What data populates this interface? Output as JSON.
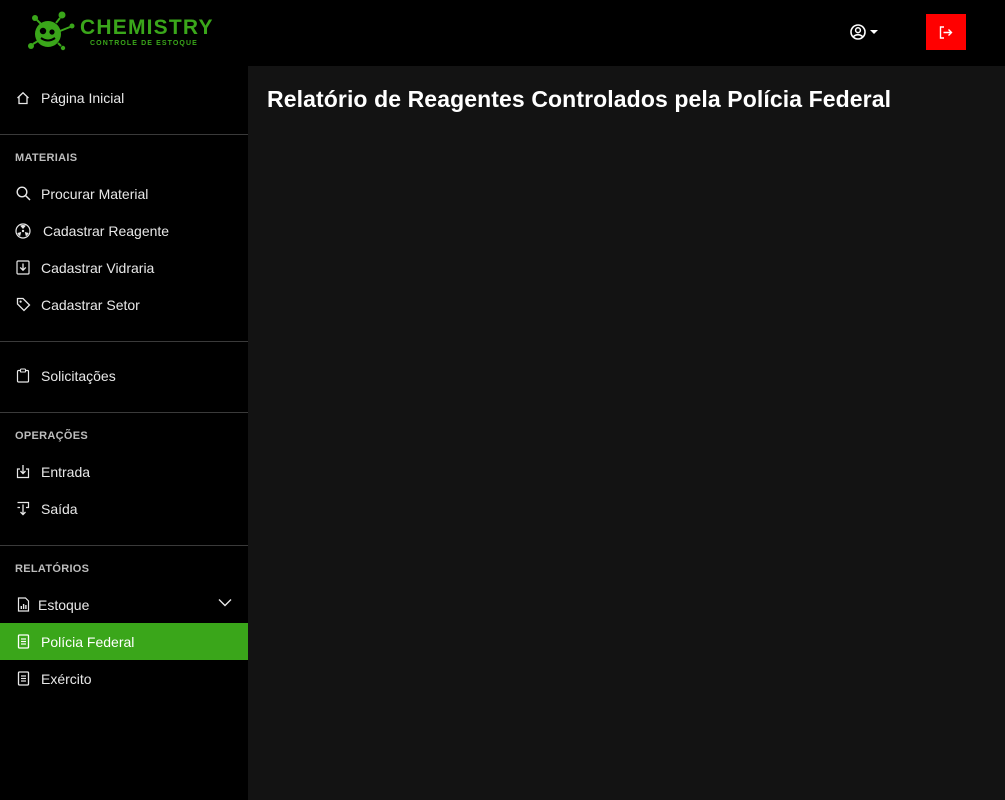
{
  "brand": {
    "title": "CHEMISTRY",
    "subtitle": "CONTROLE DE ESTOQUE",
    "color": "#3aa61a"
  },
  "header": {
    "user_icon": "user-circle-icon",
    "logout_icon": "logout-icon",
    "logout_color": "#ff0000"
  },
  "sidebar": {
    "home": {
      "label": "Página Inicial",
      "icon": "home-icon"
    },
    "sections": {
      "materiais": "MATERIAIS",
      "operacoes": "OPERAÇÕES",
      "relatorios": "RELATÓRIOS"
    },
    "materiais": [
      {
        "label": "Procurar Material",
        "icon": "search-icon"
      },
      {
        "label": "Cadastrar Reagente",
        "icon": "radiation-icon"
      },
      {
        "label": "Cadastrar Vidraria",
        "icon": "download-box-icon"
      },
      {
        "label": "Cadastrar Setor",
        "icon": "tag-icon"
      }
    ],
    "solicitacoes": {
      "label": "Solicitações",
      "icon": "clipboard-icon"
    },
    "operacoes": [
      {
        "label": "Entrada",
        "icon": "entrada-icon"
      },
      {
        "label": "Saída",
        "icon": "saida-icon"
      }
    ],
    "relatorios": [
      {
        "label": "Estoque",
        "icon": "chart-file-icon",
        "expandable": true
      },
      {
        "label": "Polícia Federal",
        "icon": "document-icon",
        "active": true
      },
      {
        "label": "Exército",
        "icon": "document-icon"
      }
    ],
    "active_color": "#3aa61a"
  },
  "main": {
    "title": "Relatório de Reagentes Controlados pela Polícia Federal"
  }
}
